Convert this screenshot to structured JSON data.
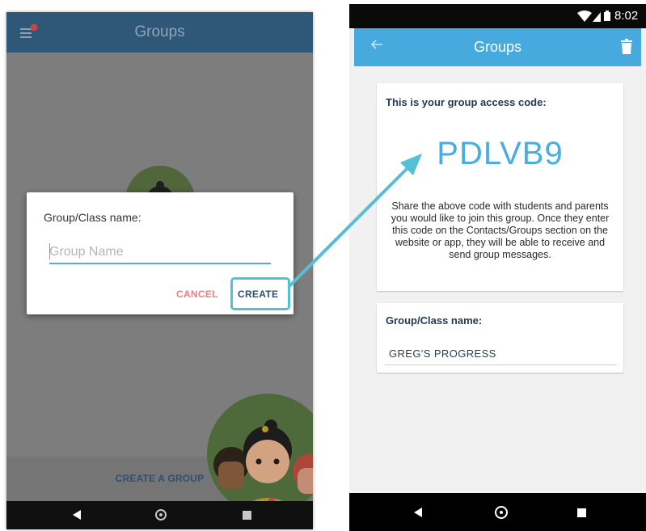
{
  "left_screen": {
    "title": "Groups",
    "notification_badge_count": "",
    "bottom_button": "CREATE A GROUP",
    "dialog": {
      "label": "Group/Class name:",
      "input_value": "",
      "input_placeholder": "Group Name",
      "cancel_label": "CANCEL",
      "create_label": "CREATE"
    }
  },
  "right_screen": {
    "status_time": "8:02",
    "title": "Groups",
    "access_code_label": "This is your group access code:",
    "access_code": "PDLVB9",
    "access_code_description": "Share the above code with students and parents you would like to join this group. Once they enter this code on the Contacts/Groups section on the website or app, they will be able to receive and send group messages.",
    "group_name_label": "Group/Class name:",
    "group_name_value": "GREG'S PROGRESS"
  },
  "colors": {
    "left_appbar": "#2f5777",
    "right_appbar": "#46aadf",
    "access_code": "#48aee2",
    "cancel": "#f07c80",
    "highlight_arrow": "#52c1d4",
    "badge": "#e34a4a"
  },
  "icons": {
    "left_menu": "hamburger-menu-icon",
    "right_back": "arrow-left-icon",
    "right_delete": "trash-icon",
    "nav_back": "triangle-back-icon",
    "nav_home": "circle-home-icon",
    "nav_recent": "square-recent-icon",
    "status_wifi": "wifi-icon",
    "status_signal": "signal-icon",
    "status_battery": "battery-icon"
  }
}
